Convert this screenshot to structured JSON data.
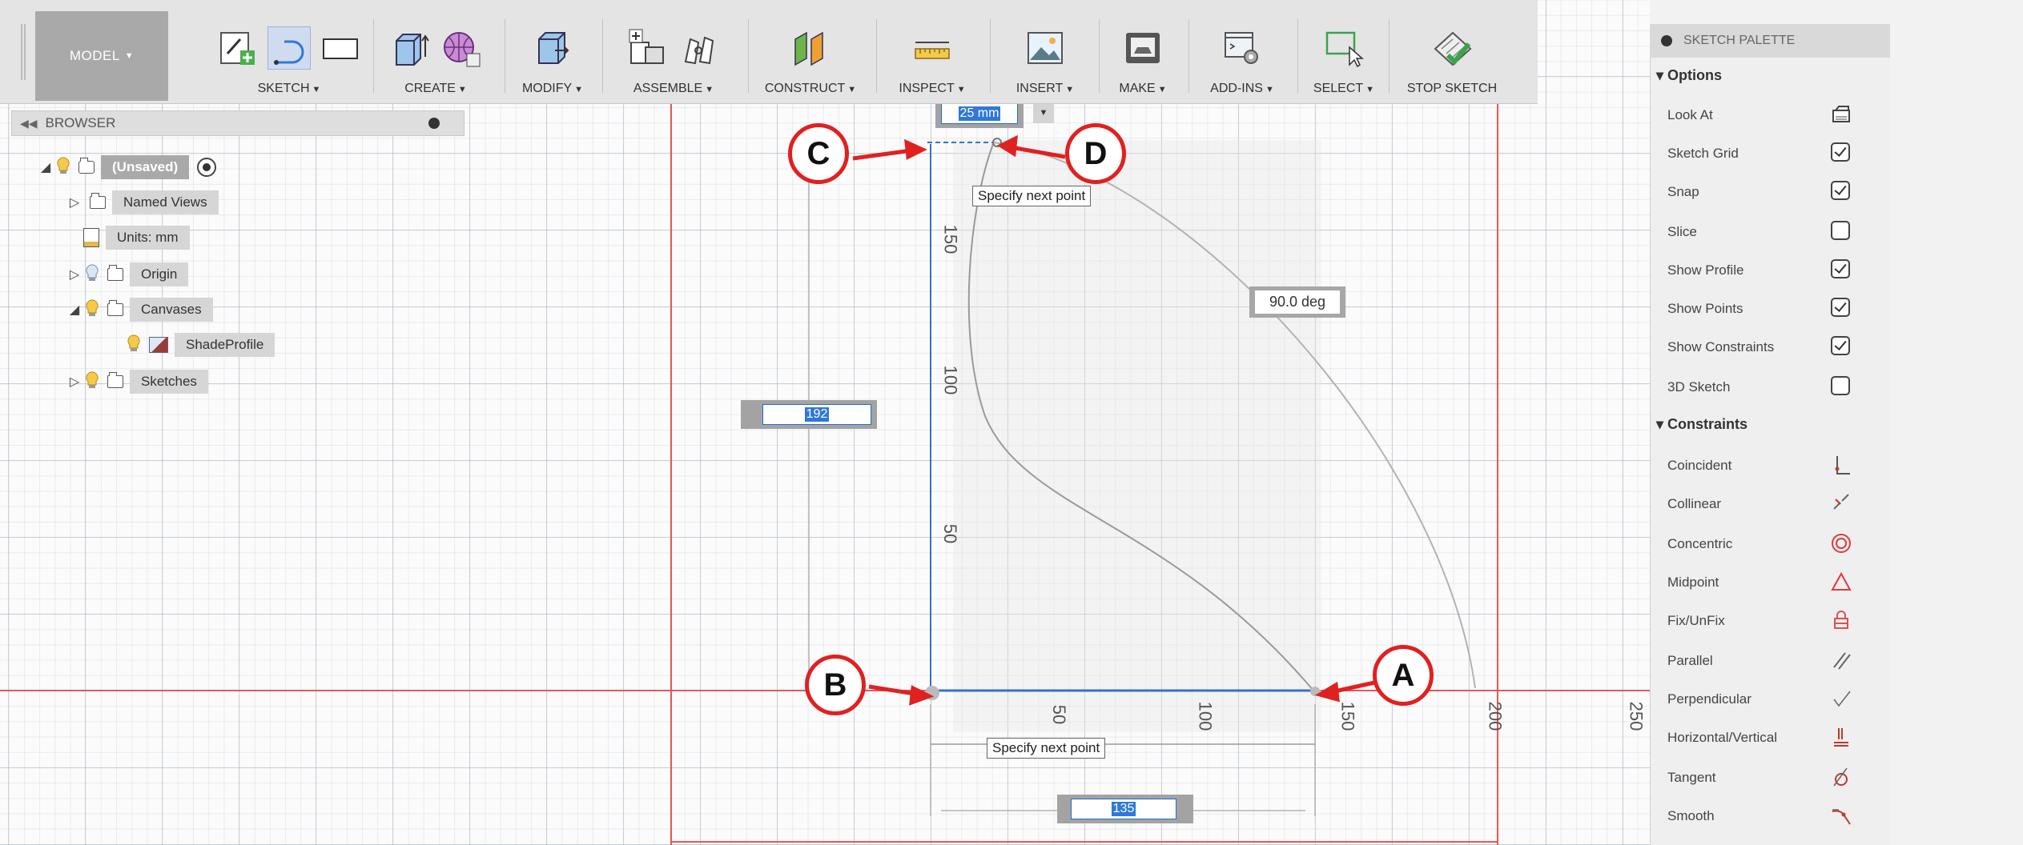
{
  "toolbar": {
    "model_label": "MODEL",
    "groups": [
      {
        "label": "SKETCH"
      },
      {
        "label": "CREATE"
      },
      {
        "label": "MODIFY"
      },
      {
        "label": "ASSEMBLE"
      },
      {
        "label": "CONSTRUCT"
      },
      {
        "label": "INSPECT"
      },
      {
        "label": "INSERT"
      },
      {
        "label": "MAKE"
      },
      {
        "label": "ADD-INS"
      },
      {
        "label": "SELECT"
      },
      {
        "label": "STOP SKETCH"
      }
    ]
  },
  "browser": {
    "title": "BROWSER",
    "root": "(Unsaved)",
    "items": [
      {
        "label": "Named Views"
      },
      {
        "label": "Units: mm"
      },
      {
        "label": "Origin"
      },
      {
        "label": "Canvases"
      },
      {
        "label": "ShadeProfile"
      },
      {
        "label": "Sketches"
      }
    ]
  },
  "palette": {
    "title": "SKETCH PALETTE",
    "options_title": "Options",
    "options": [
      {
        "label": "Look At",
        "icon": "look-at-icon"
      },
      {
        "label": "Sketch Grid",
        "checked": true
      },
      {
        "label": "Snap",
        "checked": true
      },
      {
        "label": "Slice",
        "checked": false
      },
      {
        "label": "Show Profile",
        "checked": true
      },
      {
        "label": "Show Points",
        "checked": true
      },
      {
        "label": "Show Constraints",
        "checked": true
      },
      {
        "label": "3D Sketch",
        "checked": false
      }
    ],
    "constraints_title": "Constraints",
    "constraints": [
      {
        "label": "Coincident",
        "icon": "coincident-icon",
        "color": "#c0392b"
      },
      {
        "label": "Collinear",
        "icon": "collinear-icon",
        "color": "#666666"
      },
      {
        "label": "Concentric",
        "icon": "concentric-icon",
        "color": "#e03b3b"
      },
      {
        "label": "Midpoint",
        "icon": "midpoint-icon",
        "color": "#e03b3b"
      },
      {
        "label": "Fix/UnFix",
        "icon": "fix-icon",
        "color": "#d9534f"
      },
      {
        "label": "Parallel",
        "icon": "parallel-icon",
        "color": "#666666"
      },
      {
        "label": "Perpendicular",
        "icon": "perpendicular-icon",
        "color": "#666666"
      },
      {
        "label": "Horizontal/Vertical",
        "icon": "horizontal-vertical-icon",
        "color": "#c0392b"
      },
      {
        "label": "Tangent",
        "icon": "tangent-icon",
        "color": "#c0392b"
      },
      {
        "label": "Smooth",
        "icon": "smooth-icon",
        "color": "#c0392b"
      }
    ]
  },
  "canvas": {
    "top_dim_value": "25 mm",
    "left_dim_value": "192",
    "bottom_dim_value": "135",
    "angle_value": "90.0 deg",
    "tip_top": "Specify next point",
    "tip_bottom": "Specify next point",
    "ruler_vertical": [
      "150",
      "100",
      "50"
    ],
    "ruler_horizontal": [
      "50",
      "100",
      "150",
      "200",
      "250"
    ],
    "callouts": [
      "A",
      "B",
      "C",
      "D"
    ]
  },
  "colors": {
    "callout_red": "#e12020",
    "sketch_line_blue": "#3a6fc9",
    "axis_red": "#e05a5a"
  }
}
